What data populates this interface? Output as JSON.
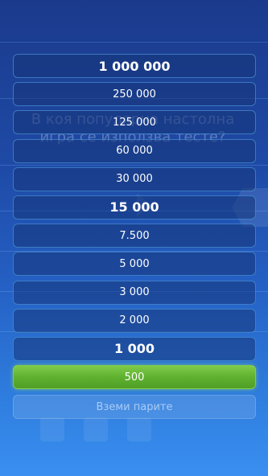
{
  "background": {
    "question": "В коя популярна настолна игра се използва тесте?"
  },
  "ladder": {
    "prizes": [
      {
        "label": "1 000 000",
        "milestone": true
      },
      {
        "label": "250 000",
        "milestone": false
      },
      {
        "label": "125 000",
        "milestone": false
      },
      {
        "label": "60 000",
        "milestone": false
      },
      {
        "label": "30 000",
        "milestone": false
      },
      {
        "label": "15 000",
        "milestone": true
      },
      {
        "label": "7.500",
        "milestone": false
      },
      {
        "label": "5 000",
        "milestone": false
      },
      {
        "label": "3 000",
        "milestone": false
      },
      {
        "label": "2 000",
        "milestone": false
      },
      {
        "label": "1 000",
        "milestone": true
      },
      {
        "label": "500",
        "milestone": false,
        "current": true
      }
    ]
  },
  "take_money": {
    "label": "Вземи парите"
  },
  "colors": {
    "current_rung": "#5fb12f",
    "background_top": "#1b3a8c",
    "background_bottom": "#3a8ff0"
  }
}
